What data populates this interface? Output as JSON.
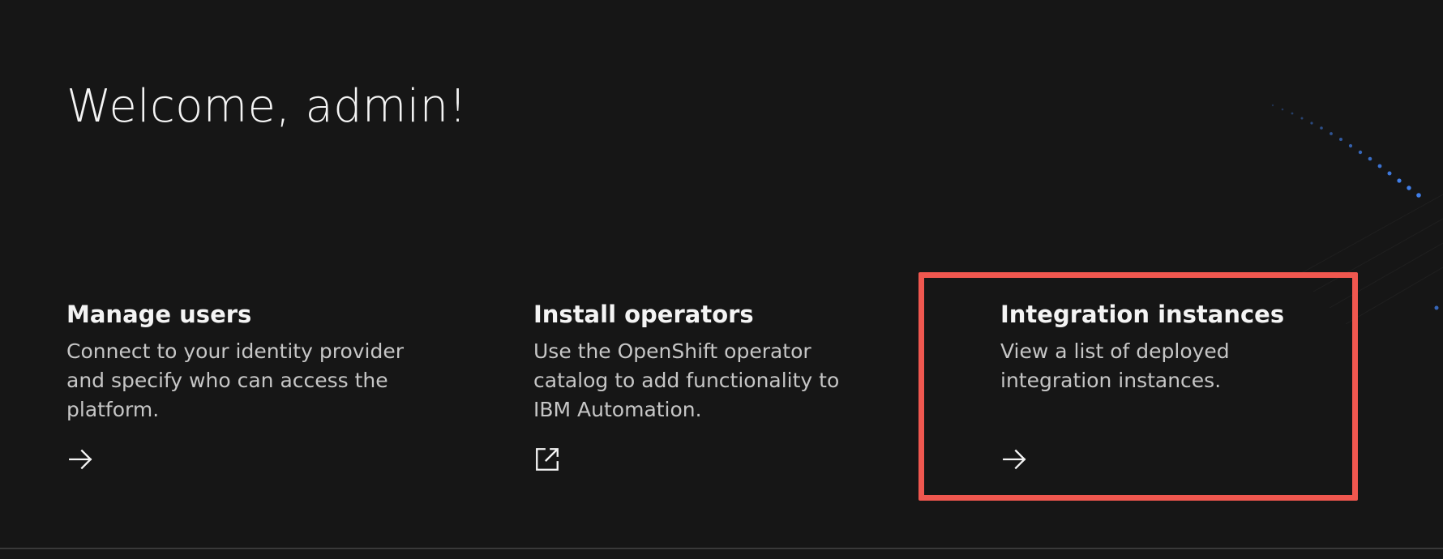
{
  "welcome": {
    "title": "Welcome, admin!"
  },
  "tiles": [
    {
      "heading": "Manage users",
      "description": "Connect to your identity provider and specify who can access the platform.",
      "icon": "arrow-right-icon"
    },
    {
      "heading": "Install operators",
      "description": "Use the OpenShift operator catalog to add functionality to IBM Automation.",
      "icon": "launch-icon"
    },
    {
      "heading": "Integration instances",
      "description": "View a list of deployed integration instances.",
      "icon": "arrow-right-icon"
    }
  ],
  "colors": {
    "background": "#161616",
    "text_primary": "#f4f4f4",
    "text_secondary": "#c6c6c6",
    "highlight": "#f0574f",
    "decor_dots": "#4589ff"
  }
}
